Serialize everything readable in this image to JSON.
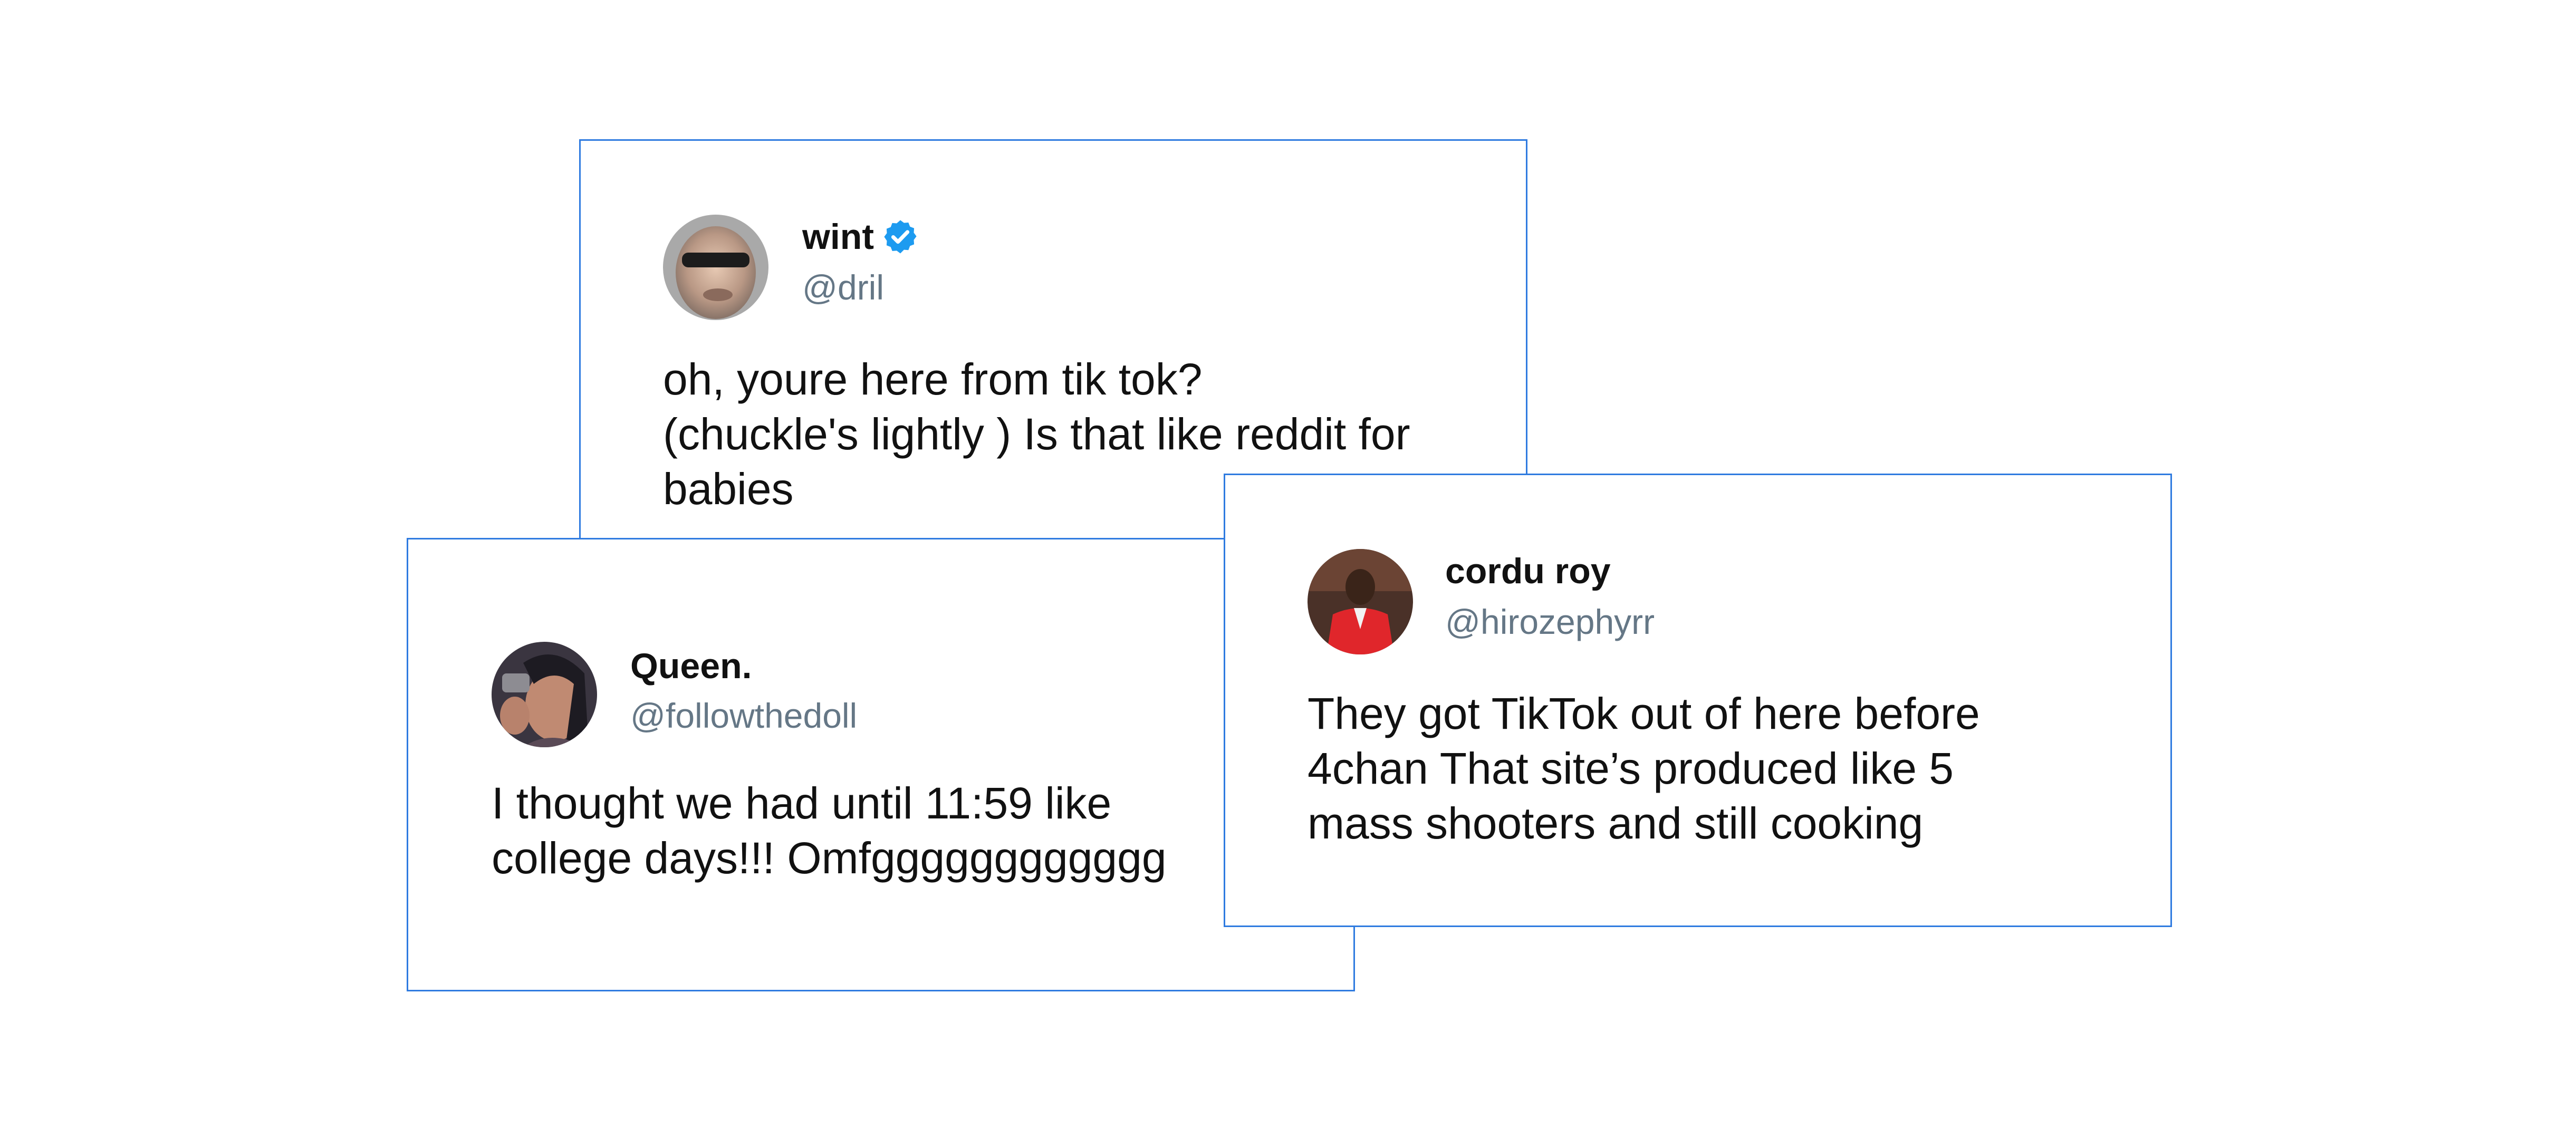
{
  "tweets": [
    {
      "name": "wint",
      "handle": "@dril",
      "verified": true,
      "text": "oh, youre here from tik tok?\n(chuckle's lightly ) Is that like reddit for\nbabies"
    },
    {
      "name": "Queen.",
      "handle": "@followthedoll",
      "verified": false,
      "text": "I thought we had until 11:59 like\ncollege days!!! Omfgggggggggggg"
    },
    {
      "name": "cordu roy",
      "handle": "@hirozephyrr",
      "verified": false,
      "text": "They got TikTok out of here before\n4chan   That site’s produced like 5\nmass shooters and still cooking"
    }
  ],
  "colors": {
    "card_border": "#2f7be0",
    "handle": "#657786",
    "verified_badge": "#1d9bf0"
  }
}
